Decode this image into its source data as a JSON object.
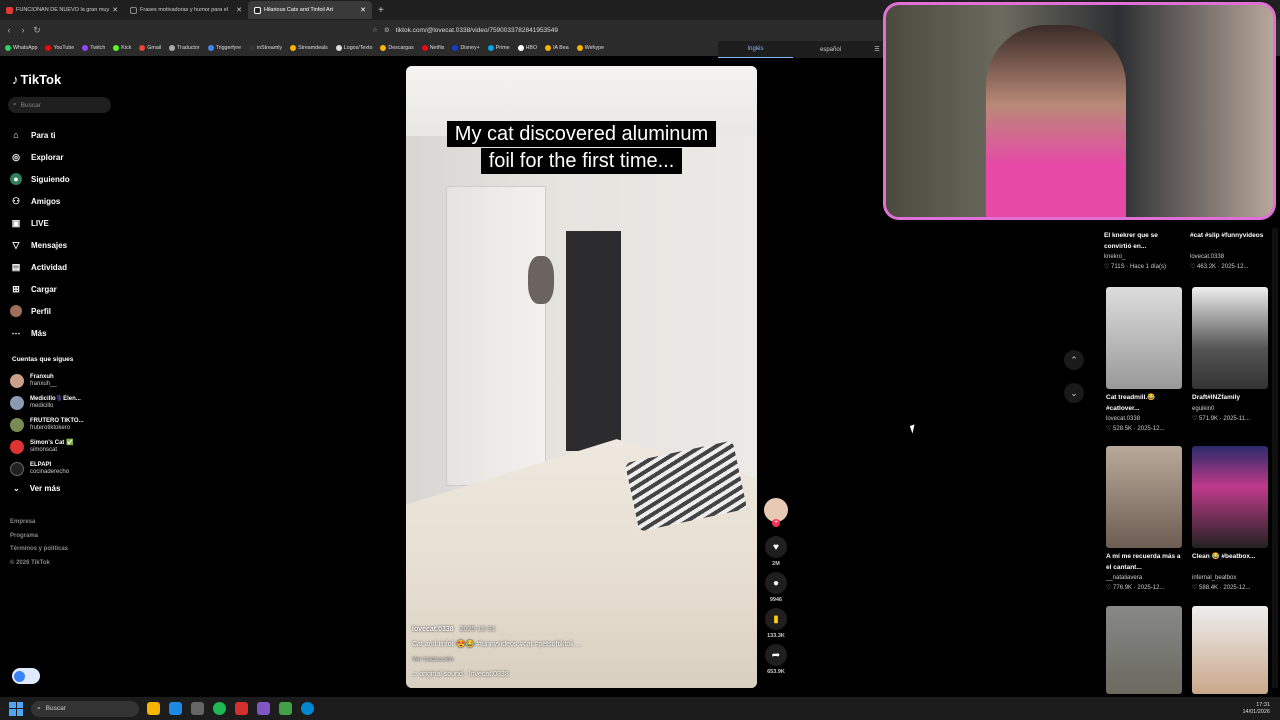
{
  "browser": {
    "tabs": [
      {
        "title": "FUNCIONAN DE NUEVO la gran muy",
        "color": "#e53935"
      },
      {
        "title": "Frases motivadoras y humor para el",
        "color": "#888888"
      },
      {
        "title": "Hilarious Cats and Tinfoil Art",
        "color": "#ffffff"
      }
    ],
    "url": "tiktok.com/@lovecat.0338/video/7590033782841953549",
    "bookmarks": [
      "WhatsApp",
      "YouTube",
      "Twitch",
      "Kick",
      "Gmail",
      "Traductor",
      "Triggerfyre",
      "inStreamly",
      "Streamdeals",
      "Logos/Texto",
      "Descargas",
      "Netflix",
      "Disney+",
      "Prime",
      "HBO",
      "IA Bea",
      "Wehype"
    ],
    "translate": {
      "lang1": "Inglés",
      "lang2": "español"
    }
  },
  "sidebar": {
    "logo": "TikTok",
    "search_placeholder": "Buscar",
    "menu": [
      {
        "label": "Para ti",
        "icon": "home-icon"
      },
      {
        "label": "Explorar",
        "icon": "compass-icon"
      },
      {
        "label": "Siguiendo",
        "icon": "following-icon"
      },
      {
        "label": "Amigos",
        "icon": "friends-icon"
      },
      {
        "label": "LIVE",
        "icon": "live-icon"
      },
      {
        "label": "Mensajes",
        "icon": "messages-icon"
      },
      {
        "label": "Actividad",
        "icon": "activity-icon"
      },
      {
        "label": "Cargar",
        "icon": "upload-icon"
      },
      {
        "label": "Perfil",
        "icon": "profile-icon"
      },
      {
        "label": "Más",
        "icon": "more-icon"
      }
    ],
    "following_title": "Cuentas que sigues",
    "following": [
      {
        "name": "Franxuh",
        "handle": "franxuh__"
      },
      {
        "name": "Medicillo⚕️Elen...",
        "handle": "medicillo"
      },
      {
        "name": "FRUTERO TIKTO...",
        "handle": "fruterotiktokero"
      },
      {
        "name": "Simon's Cat ✅",
        "handle": "simonscat"
      },
      {
        "name": "ELPAPI",
        "handle": "cocinaderecho"
      }
    ],
    "see_more": "Ver más",
    "footer": [
      "Empresa",
      "Programa",
      "Términos y políticas",
      "© 2026 TikTok"
    ]
  },
  "video": {
    "caption_overlay": "My cat discovered aluminum foil for the first time...",
    "author": "lovecat.0338",
    "date": "2025-12-31",
    "description": "Cat and tinfoil 😍😂 #funnyvideos #cat #petsoftiktok ...",
    "see_translation": "Ver traducción",
    "sound": "original sound - lovecat.0338",
    "likes": "2M",
    "comments": "9946",
    "saves": "133.3K",
    "shares": "653.9K"
  },
  "recommendations": [
    {
      "title": "El knekrer que se convirtió en...",
      "user": "knekro_",
      "stats": "♡ 711S · Hace 1 día(s)"
    },
    {
      "title": "#cat #slip #funnyvideos",
      "user": "lovecat.0338",
      "stats": "♡ 463.2K · 2025-12..."
    },
    {
      "title": "Cat treadmill.😂 #catlover...",
      "user": "lovecat.0338",
      "stats": "♡ 528.5K · 2025-12..."
    },
    {
      "title": "Draft#INZfamily",
      "user": "eguikin0",
      "stats": "♡ 571.9K · 2025-11..."
    },
    {
      "title": "A mí me recuerda más a el cantant...",
      "user": "__nataliavera",
      "stats": "♡ 776.9K · 2025-12..."
    },
    {
      "title": "Clean 😂 #beatbox...",
      "user": "infernal_beatbox",
      "stats": "♡ 588.4K · 2025-12..."
    }
  ],
  "taskbar": {
    "search": "Buscar",
    "time": "17:31",
    "date": "14/01/2026"
  }
}
